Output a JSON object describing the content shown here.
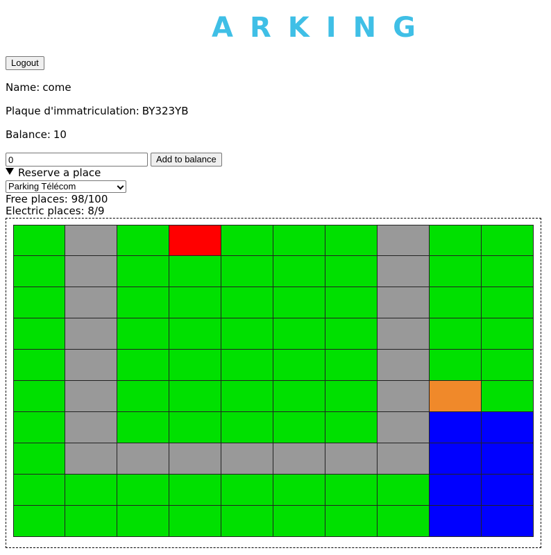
{
  "header": {
    "logo_text": "ARKING"
  },
  "actions": {
    "logout_label": "Logout",
    "add_balance_label": "Add to balance"
  },
  "user": {
    "name_label": "Name:",
    "name_value": "come",
    "plate_label": "Plaque d'immatriculation:",
    "plate_value": "BY323YB",
    "balance_label": "Balance:",
    "balance_value": "10"
  },
  "balance_input": {
    "value": "0"
  },
  "reserve": {
    "summary_label": "Reserve a place",
    "selected_parking": "Parking Télécom",
    "free_places": "Free places: 98/100",
    "electric_places": "Electric places: 8/9"
  },
  "legend_colors": {
    "free": "#00e000",
    "road": "#999999",
    "occupied": "#ff0000",
    "reserved": "#f0892a",
    "electric": "#0000ff"
  },
  "parking_grid": {
    "rows": [
      [
        "free",
        "road",
        "free",
        "occupied",
        "free",
        "free",
        "free",
        "road",
        "free",
        "free"
      ],
      [
        "free",
        "road",
        "free",
        "free",
        "free",
        "free",
        "free",
        "road",
        "free",
        "free"
      ],
      [
        "free",
        "road",
        "free",
        "free",
        "free",
        "free",
        "free",
        "road",
        "free",
        "free"
      ],
      [
        "free",
        "road",
        "free",
        "free",
        "free",
        "free",
        "free",
        "road",
        "free",
        "free"
      ],
      [
        "free",
        "road",
        "free",
        "free",
        "free",
        "free",
        "free",
        "road",
        "free",
        "free"
      ],
      [
        "free",
        "road",
        "free",
        "free",
        "free",
        "free",
        "free",
        "road",
        "reserved",
        "free"
      ],
      [
        "free",
        "road",
        "free",
        "free",
        "free",
        "free",
        "free",
        "road",
        "electric",
        "electric"
      ],
      [
        "free",
        "road",
        "road",
        "road",
        "road",
        "road",
        "road",
        "road",
        "electric",
        "electric"
      ],
      [
        "free",
        "free",
        "free",
        "free",
        "free",
        "free",
        "free",
        "free",
        "electric",
        "electric"
      ],
      [
        "free",
        "free",
        "free",
        "free",
        "free",
        "free",
        "free",
        "free",
        "electric",
        "electric"
      ]
    ]
  }
}
